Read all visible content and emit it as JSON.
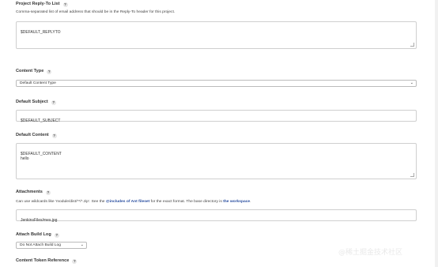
{
  "reply_to": {
    "label": "Project Reply-To List",
    "help": "?",
    "description": "Comma-separated list of email address that should be in the Reply-To header for this project.",
    "value": "$DEFAULT_REPLYTO"
  },
  "content_type": {
    "label": "Content Type",
    "help": "?",
    "selected": "Default Content Type",
    "chevron": "chevron-down-icon"
  },
  "default_subject": {
    "label": "Default Subject",
    "help": "?",
    "value": "$DEFAULT_SUBJECT"
  },
  "default_content": {
    "label": "Default Content",
    "help": "?",
    "value": "$DEFAULT_CONTENT\nhello"
  },
  "attachments": {
    "label": "Attachments",
    "help": "?",
    "desc_prefix": "Can use wildcards like 'module/dist/**/*.zip'. See the ",
    "desc_link1": "@includes of Ant fileset",
    "desc_middle": " for the exact format. The base directory is ",
    "desc_link2": "the workspace",
    "desc_suffix": ".",
    "value": "JenkinsFiles/mes.jpg"
  },
  "attach_build_log": {
    "label": "Attach Build Log",
    "help": "?",
    "selected": "Do Not Attach Build Log"
  },
  "content_token_reference": {
    "label": "Content Token Reference",
    "help": "?"
  },
  "watermark": "@稀土掘金技术社区"
}
